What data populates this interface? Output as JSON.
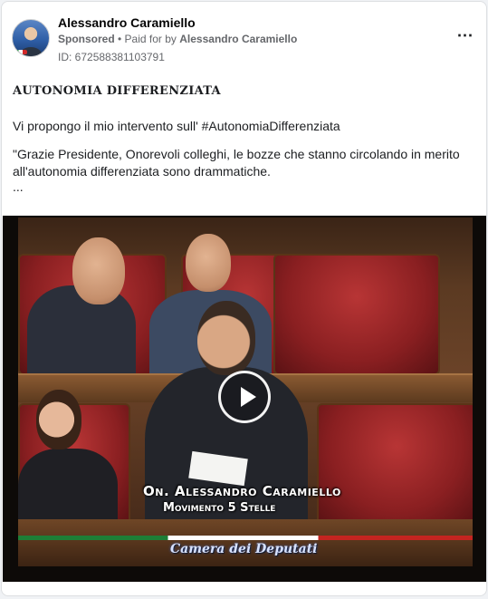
{
  "post": {
    "author": "Alessandro Caramiello",
    "sponsored": "Sponsored",
    "paid_prefix": " • Paid for by ",
    "paid_by": "Alessandro Caramiello",
    "ad_id": "ID: 672588381103791",
    "more_icon": "⋯",
    "headline": "AUTONOMIA DIFFERENZIATA",
    "intro": "Vi propongo il mio intervento sull' #AutonomiaDifferenziata",
    "quote": "\"Grazie Presidente, Onorevoli colleghi, le bozze che stanno circolando in merito all'autonomia differenziata sono drammatiche.",
    "ellipsis": "..."
  },
  "video": {
    "caption_line1": "On. Alessandro Caramiello",
    "caption_line2": "Movimento 5 Stelle",
    "chamber_logo": "Camera dei Deputati",
    "play_icon": "play-icon"
  },
  "colors": {
    "text_primary": "#050505",
    "text_secondary": "#65676b",
    "flag_green": "#1d7e36",
    "flag_red": "#c42420"
  }
}
